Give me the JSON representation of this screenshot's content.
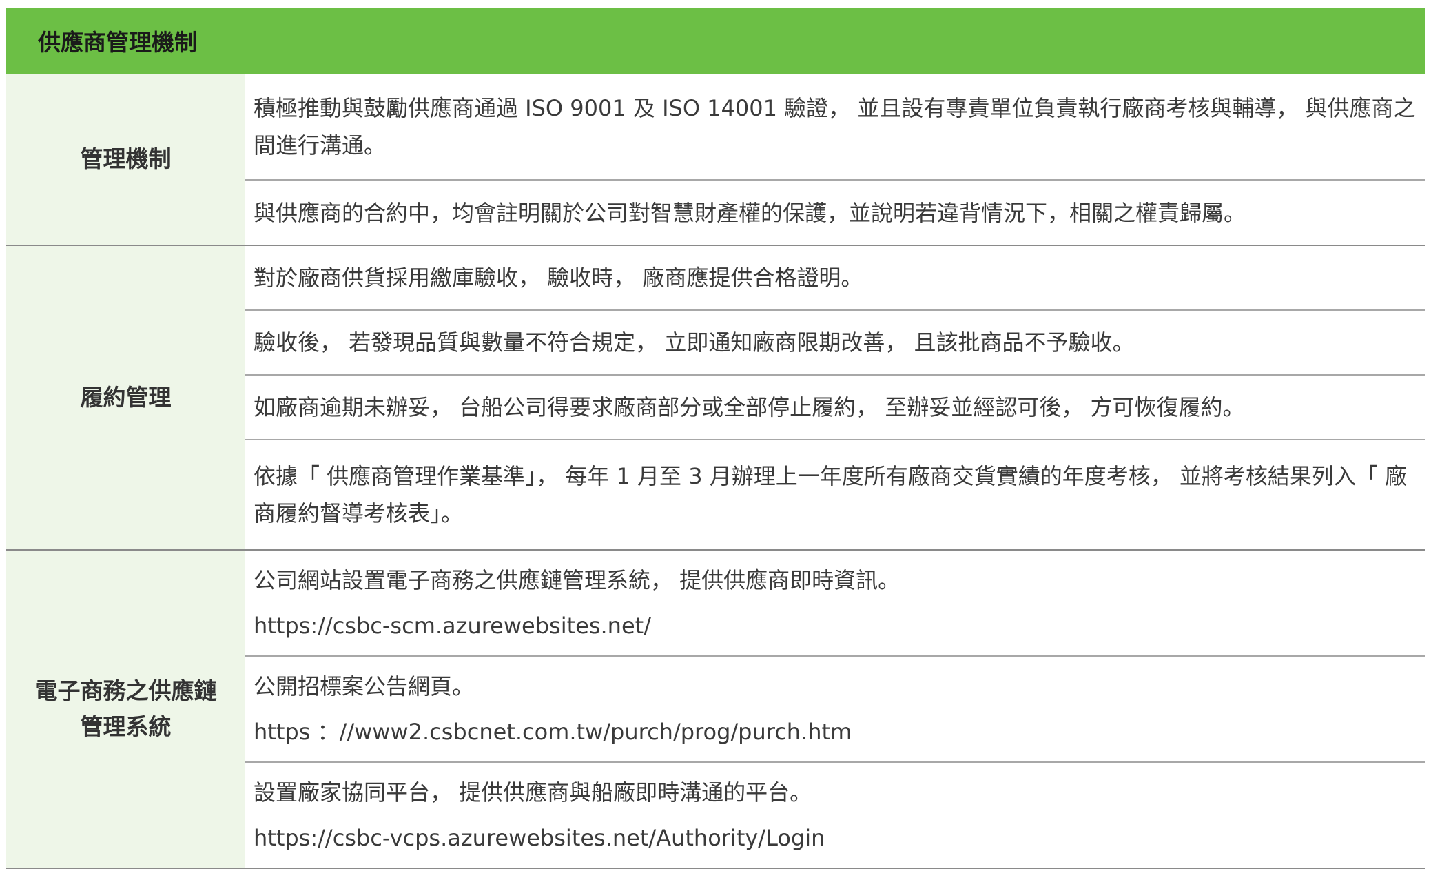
{
  "header": {
    "title": "供應商管理機制"
  },
  "sections": [
    {
      "label": "管理機制",
      "rows": [
        {
          "text": "積極推動與鼓勵供應商通過 ISO 9001 及 ISO 14001 驗證， 並且設有專責單位負責執行廠商考核與輔導， 與供應商之間進行溝通。"
        },
        {
          "text": "與供應商的合約中，均會註明關於公司對智慧財產權的保護，並說明若違背情況下，相關之權責歸屬。"
        }
      ]
    },
    {
      "label": "履約管理",
      "rows": [
        {
          "text": "對於廠商供貨採用繳庫驗收， 驗收時， 廠商應提供合格證明。"
        },
        {
          "text": "驗收後， 若發現品質與數量不符合規定， 立即通知廠商限期改善， 且該批商品不予驗收。"
        },
        {
          "text": "如廠商逾期未辦妥， 台船公司得要求廠商部分或全部停止履約， 至辦妥並經認可後， 方可恢復履約。"
        },
        {
          "text": "依據「 供應商管理作業基準」， 每年 1 月至 3 月辦理上一年度所有廠商交貨實績的年度考核， 並將考核結果列入「 廠商履約督導考核表」。"
        }
      ]
    },
    {
      "label_line1": "電子商務之供應鏈",
      "label_line2": "管理系統",
      "rows": [
        {
          "text": "公司網站設置電子商務之供應鏈管理系統， 提供供應商即時資訊。",
          "link": "https://csbc-scm.azurewebsites.net/"
        },
        {
          "text": "公開招標案公告網頁。",
          "link": "https ：//www2.csbcnet.com.tw/purch/prog/purch.htm"
        },
        {
          "text": "設置廠家協同平台， 提供供應商與船廠即時溝通的平台。",
          "link": "https://csbc-vcps.azurewebsites.net/Authority/Login"
        }
      ]
    }
  ]
}
